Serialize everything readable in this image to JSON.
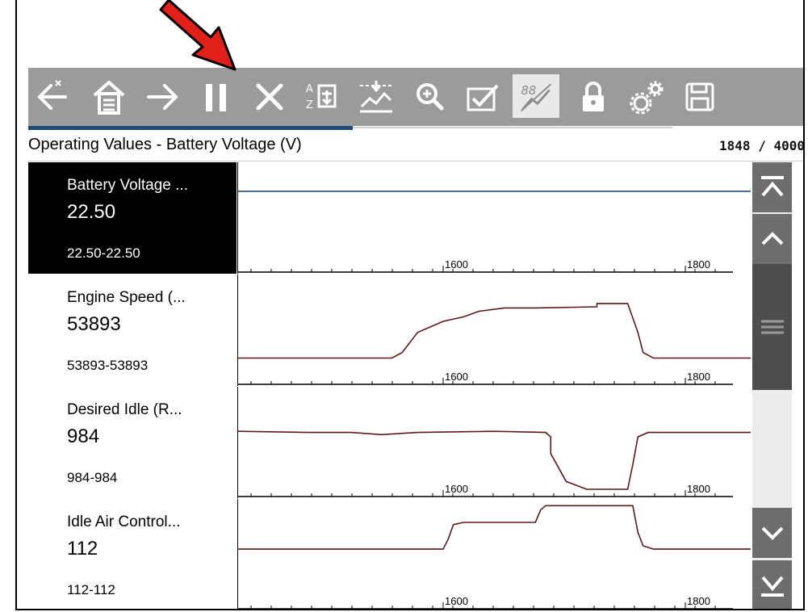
{
  "toolbar": {
    "buttons": [
      {
        "name": "back-icon"
      },
      {
        "name": "home-icon"
      },
      {
        "name": "forward-icon"
      },
      {
        "name": "pause-icon"
      },
      {
        "name": "close-icon"
      },
      {
        "name": "sort-icon"
      },
      {
        "name": "zoom-fit-graph-icon"
      },
      {
        "name": "zoom-icon"
      },
      {
        "name": "checklist-icon"
      },
      {
        "name": "graph-view-icon",
        "active": true
      },
      {
        "name": "lock-icon"
      },
      {
        "name": "settings-gears-icon"
      },
      {
        "name": "save-icon"
      }
    ]
  },
  "progress": {
    "current": 1848,
    "total": 4000
  },
  "header": {
    "title": "Operating Values - Battery Voltage (V)",
    "count": "1848 / 4000"
  },
  "rows": [
    {
      "name": "Battery Voltage ...",
      "value": "22.50",
      "range": "22.50-22.50",
      "selected": true,
      "ticks": [
        "1600",
        "1800"
      ],
      "line_color": "#1f4a78",
      "trace": [
        [
          0,
          0.26
        ],
        [
          1,
          0.26
        ]
      ]
    },
    {
      "name": "Engine Speed (...",
      "value": "53893",
      "range": "53893-53893",
      "selected": false,
      "ticks": [
        "1600",
        "1800"
      ],
      "line_color": "#5a1a1a",
      "trace": [
        [
          0,
          0.75
        ],
        [
          0.3,
          0.75
        ],
        [
          0.32,
          0.7
        ],
        [
          0.35,
          0.52
        ],
        [
          0.4,
          0.42
        ],
        [
          0.44,
          0.38
        ],
        [
          0.47,
          0.33
        ],
        [
          0.52,
          0.3
        ],
        [
          0.58,
          0.3
        ],
        [
          0.7,
          0.29
        ],
        [
          0.7,
          0.26
        ],
        [
          0.76,
          0.26
        ],
        [
          0.78,
          0.52
        ],
        [
          0.79,
          0.7
        ],
        [
          0.81,
          0.75
        ],
        [
          1,
          0.75
        ]
      ]
    },
    {
      "name": "Desired Idle (R...",
      "value": "984",
      "range": "984-984",
      "selected": false,
      "ticks": [
        "1600",
        "1800"
      ],
      "line_color": "#5a1a1a",
      "trace": [
        [
          0,
          0.4
        ],
        [
          0.14,
          0.41
        ],
        [
          0.22,
          0.41
        ],
        [
          0.28,
          0.43
        ],
        [
          0.35,
          0.41
        ],
        [
          0.5,
          0.4
        ],
        [
          0.6,
          0.41
        ],
        [
          0.61,
          0.45
        ],
        [
          0.61,
          0.6
        ],
        [
          0.64,
          0.85
        ],
        [
          0.68,
          0.92
        ],
        [
          0.71,
          0.92
        ],
        [
          0.76,
          0.92
        ],
        [
          0.77,
          0.7
        ],
        [
          0.78,
          0.45
        ],
        [
          0.8,
          0.41
        ],
        [
          1,
          0.41
        ]
      ]
    },
    {
      "name": "Idle Air Control...",
      "value": "112",
      "range": "112-112",
      "selected": false,
      "ticks": [
        "1600",
        "1800"
      ],
      "line_color": "#5a1a1a",
      "trace": [
        [
          0,
          0.45
        ],
        [
          0.35,
          0.45
        ],
        [
          0.35,
          0.45
        ],
        [
          0.4,
          0.45
        ],
        [
          0.41,
          0.36
        ],
        [
          0.42,
          0.23
        ],
        [
          0.44,
          0.21
        ],
        [
          0.58,
          0.21
        ],
        [
          0.59,
          0.1
        ],
        [
          0.6,
          0.06
        ],
        [
          0.72,
          0.06
        ],
        [
          0.72,
          0.06
        ],
        [
          0.77,
          0.06
        ],
        [
          0.78,
          0.3
        ],
        [
          0.79,
          0.42
        ],
        [
          0.81,
          0.45
        ],
        [
          1,
          0.45
        ]
      ]
    }
  ],
  "scrollbar": {
    "top_icon": "scroll-to-top-icon",
    "up_icon": "scroll-up-icon",
    "thumb_icon": "scroll-thumb-grip-icon",
    "down_icon": "scroll-down-icon",
    "bottom_icon": "scroll-to-bottom-icon"
  },
  "annotation": {
    "icon": "red-arrow-callout-icon",
    "color": "#e0201a"
  }
}
